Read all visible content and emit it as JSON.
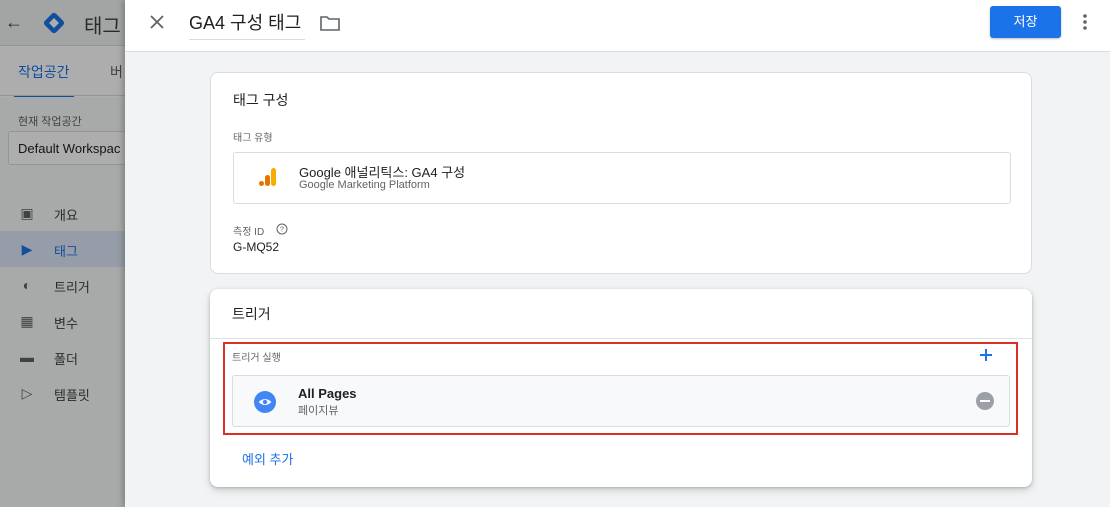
{
  "background_app": {
    "title": "태그",
    "tabs": [
      {
        "label": "작업공간"
      },
      {
        "label": "버"
      }
    ],
    "workspace_label": "현재 작업공간",
    "workspace_name": "Default Workspac",
    "nav": [
      {
        "label": "개요",
        "icon": "briefcase-icon"
      },
      {
        "label": "태그",
        "icon": "tag-icon"
      },
      {
        "label": "트리거",
        "icon": "trigger-icon"
      },
      {
        "label": "변수",
        "icon": "variables-icon"
      },
      {
        "label": "폴더",
        "icon": "folder-icon"
      },
      {
        "label": "템플릿",
        "icon": "template-icon"
      }
    ],
    "active_nav": "태그"
  },
  "header": {
    "tag_name": "GA4 구성 태그",
    "save_label": "저장"
  },
  "tag_config": {
    "title": "태그 구성",
    "type_label": "태그 유형",
    "type_name": "Google 애널리틱스: GA4 구성",
    "type_sub": "Google Marketing Platform",
    "measurement_label": "측정 ID",
    "measurement_value": "G-MQ52"
  },
  "triggers": {
    "title": "트리거",
    "firing_label": "트리거 실행",
    "items": [
      {
        "name": "All Pages",
        "type": "페이지뷰"
      }
    ],
    "exception_link": "예외 추가"
  },
  "colors": {
    "primary": "#1a73e8",
    "highlight": "#d93025",
    "ga_orange": "#f9ab00",
    "ga_dark_orange": "#e37400"
  }
}
